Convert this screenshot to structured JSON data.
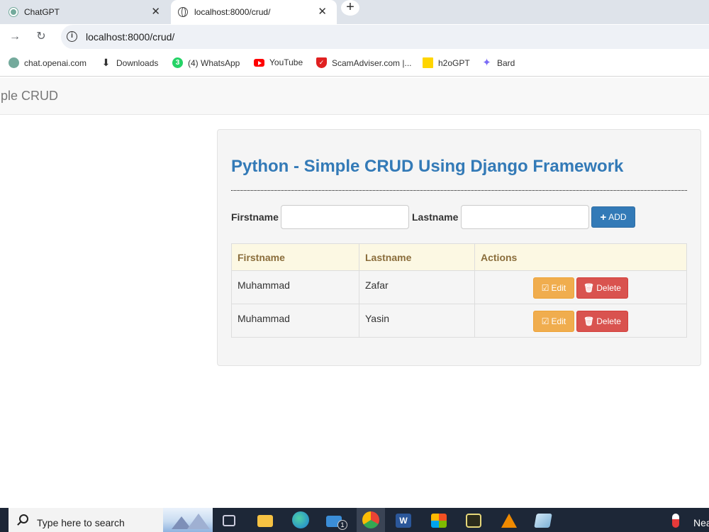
{
  "browser": {
    "tabs": [
      {
        "title": "ChatGPT",
        "close": "✕"
      },
      {
        "title": "localhost:8000/crud/",
        "close": "✕"
      }
    ],
    "new_tab": "+",
    "nav": {
      "back": "→",
      "reload": "↻"
    },
    "url": "localhost:8000/crud/",
    "info_glyph": "i",
    "bookmarks": [
      {
        "label": "chat.openai.com",
        "icon": "openai-icon",
        "color": "#74aa9c"
      },
      {
        "label": "Downloads",
        "icon": "download-icon",
        "color": "#333333"
      },
      {
        "label": "(4) WhatsApp",
        "icon": "whatsapp-icon",
        "color": "#25d366",
        "badge": "3"
      },
      {
        "label": "YouTube",
        "icon": "youtube-icon",
        "color": "#ff0000"
      },
      {
        "label": "ScamAdviser.com |...",
        "icon": "scamadviser-icon",
        "color": "#e02020"
      },
      {
        "label": "h2oGPT",
        "icon": "h2ogpt-icon",
        "color": "#ffd500"
      },
      {
        "label": "Bard",
        "icon": "bard-icon",
        "color": "#7b6cf6"
      }
    ]
  },
  "app": {
    "brand": "mple CRUD",
    "heading": "Python - Simple CRUD Using Django Framework",
    "form": {
      "firstname_label": "Firstname",
      "firstname_value": "",
      "lastname_label": "Lastname",
      "lastname_value": "",
      "add_button": "ADD",
      "add_icon": "+"
    },
    "table": {
      "headers": [
        "Firstname",
        "Lastname",
        "Actions"
      ],
      "rows": [
        {
          "firstname": "Muhammad",
          "lastname": "Zafar"
        },
        {
          "firstname": "Muhammad",
          "lastname": "Yasin"
        }
      ],
      "edit_label": "Edit",
      "delete_label": "Delete"
    },
    "colors": {
      "primary": "#337ab7",
      "warning": "#f0ad4e",
      "danger": "#d9534f",
      "table_header_bg": "#fcf8e3"
    }
  },
  "taskbar": {
    "search_placeholder": "Type here to search",
    "mail_badge": "1",
    "tray_text": "Nea",
    "apps": [
      "task-view-icon",
      "file-explorer-icon",
      "edge-icon",
      "mail-icon",
      "chrome-icon",
      "word-icon",
      "store-icon",
      "app-icon",
      "vlc-icon",
      "notepad-icon",
      "weather-icon"
    ]
  }
}
